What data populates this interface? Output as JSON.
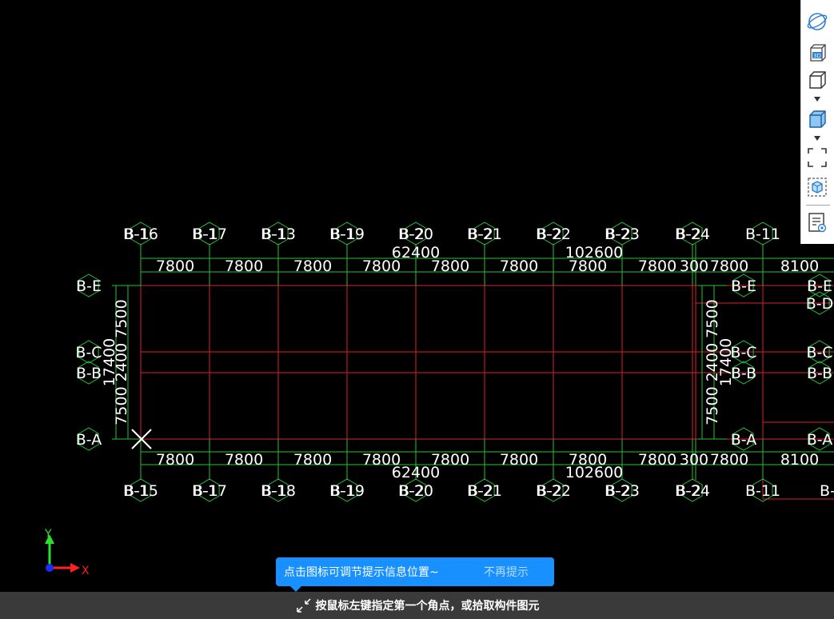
{
  "colors": {
    "grid": "#d8222a",
    "dim": "#23c33a",
    "text": "#ffffff",
    "accent": "#1890ff"
  },
  "axes": {
    "top": [
      "B-16",
      "B-17",
      "B-13",
      "B-19",
      "B-20",
      "B-21",
      "B-22",
      "B-23",
      "B-24",
      "B-11"
    ],
    "bottom": [
      "B-15",
      "B-17",
      "B-18",
      "B-19",
      "B-20",
      "B-21",
      "B-22",
      "B-23",
      "B-24",
      "B-11"
    ],
    "overlap_top": [
      "B-1",
      "B-1",
      "B-1",
      "B-1",
      "B-2",
      "B-2",
      "B-2",
      "B-2",
      "B-2"
    ],
    "overlap_bottom": [
      "B-1",
      "B-1",
      "B-1",
      "B-1",
      "B-2",
      "B-2",
      "B-2",
      "B-2",
      "B-2"
    ],
    "left": [
      "B-E",
      "B-C",
      "B-B",
      "B-A"
    ],
    "mid": [
      "B-E",
      "B-C",
      "B-B",
      "B-A"
    ],
    "right": [
      "B-E",
      "B-D",
      "B-C",
      "B-B",
      "B-A"
    ],
    "right_bottom_partial": "B-"
  },
  "dims": {
    "top_bays": [
      "7800",
      "7800",
      "7800",
      "7800",
      "7800",
      "7800",
      "7800",
      "7800",
      "300",
      "7800",
      "8100"
    ],
    "bottom_bays": [
      "7800",
      "7800",
      "7800",
      "7800",
      "7800",
      "7800",
      "7800",
      "7800",
      "300",
      "7800",
      "8100"
    ],
    "top_total_a": "62400",
    "top_total_b": "102600",
    "bottom_total_a": "62400",
    "bottom_total_b": "102600",
    "left_bays": [
      "7500",
      "2400",
      "7500"
    ],
    "left_total": "17400",
    "mid_bays": [
      "7500",
      "2400",
      "7500"
    ],
    "mid_total": "17400"
  },
  "ucs": {
    "y_label": "Y",
    "x_label": "X"
  },
  "toolbar": {
    "icons": [
      "orbit-icon",
      "3d-view-icon",
      "cube-wire-icon",
      "caret-down-icon",
      "cube-solid-icon",
      "caret-down-icon",
      "fullscreen-icon",
      "dynamic-observe-icon",
      "layer-settings-icon"
    ]
  },
  "tooltip": {
    "text": "点击图标可调节提示信息位置~",
    "dismiss": "不再提示"
  },
  "status": {
    "text": "按鼠标左键指定第一个角点，或拾取构件图元"
  }
}
